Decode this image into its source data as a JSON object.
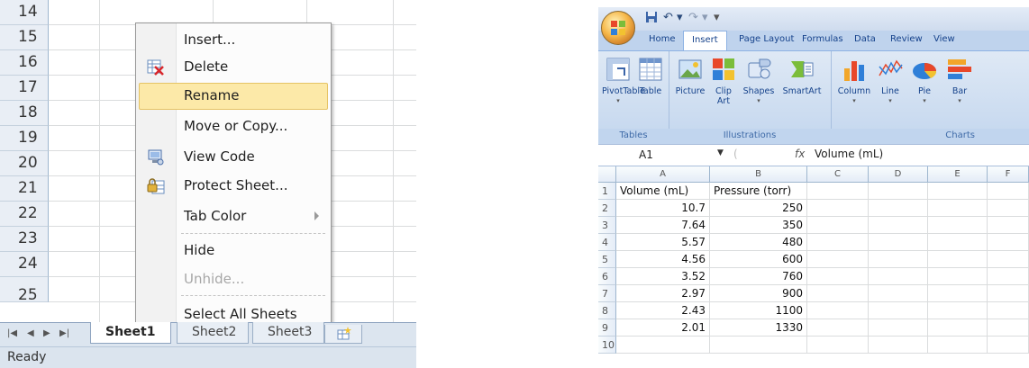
{
  "left": {
    "row_numbers": [
      "14",
      "15",
      "16",
      "17",
      "18",
      "19",
      "20",
      "21",
      "22",
      "23",
      "24",
      "25"
    ],
    "context_menu": {
      "insert": "Insert...",
      "delete": "Delete",
      "rename": "Rename",
      "move_copy": "Move or Copy...",
      "view_code": "View Code",
      "protect_sheet": "Protect Sheet...",
      "tab_color": "Tab Color",
      "hide": "Hide",
      "unhide": "Unhide...",
      "select_all_sheets": "Select All Sheets"
    },
    "sheet_tabs": [
      "Sheet1",
      "Sheet2",
      "Sheet3"
    ],
    "status": "Ready"
  },
  "right": {
    "tabs": [
      "Home",
      "Insert",
      "Page Layout",
      "Formulas",
      "Data",
      "Review",
      "View"
    ],
    "selected_tab": "Insert",
    "groups": {
      "tables": {
        "caption": "Tables",
        "pivot": "PivotTable",
        "table": "Table"
      },
      "illustrations": {
        "caption": "Illustrations",
        "picture": "Picture",
        "clip": "Clip",
        "clip2": "Art",
        "shapes": "Shapes",
        "smartart": "SmartArt"
      },
      "charts": {
        "caption": "Charts",
        "column": "Column",
        "line": "Line",
        "pie": "Pie",
        "bar": "Bar"
      }
    },
    "name_box": "A1",
    "fx": "fx",
    "formula_value": "Volume (mL)",
    "columns": [
      "A",
      "B",
      "C",
      "D",
      "E",
      "F"
    ],
    "headers": [
      "Volume (mL)",
      "Pressure (torr)"
    ],
    "rows": [
      {
        "n": "2",
        "v": "10.7",
        "p": "250"
      },
      {
        "n": "3",
        "v": "7.64",
        "p": "350"
      },
      {
        "n": "4",
        "v": "5.57",
        "p": "480"
      },
      {
        "n": "5",
        "v": "4.56",
        "p": "600"
      },
      {
        "n": "6",
        "v": "3.52",
        "p": "760"
      },
      {
        "n": "7",
        "v": "2.97",
        "p": "900"
      },
      {
        "n": "8",
        "v": "2.43",
        "p": "1100"
      },
      {
        "n": "9",
        "v": "2.01",
        "p": "1330"
      }
    ],
    "row_one": "1",
    "row_ten": "10",
    "colors": {
      "ribbon_text": "#15428b",
      "highlight": "#fce9a8",
      "office_orange": "#f6b84a"
    }
  }
}
